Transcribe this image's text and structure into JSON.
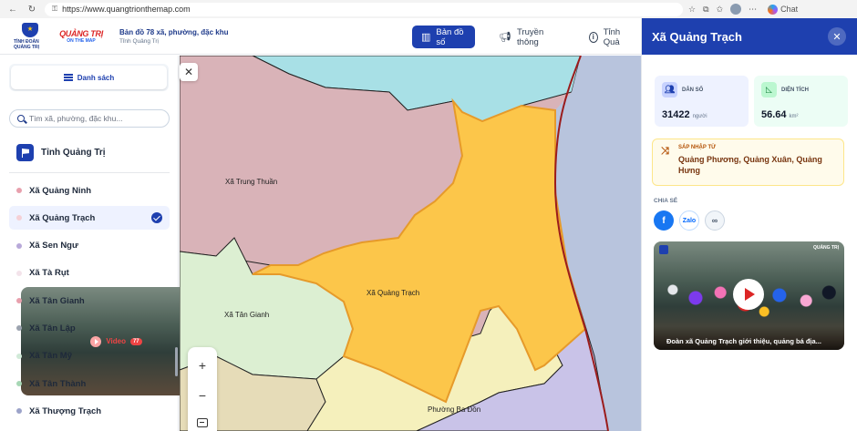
{
  "browser": {
    "url": "https://www.quangtrionthemap.com",
    "chat_label": "Chat"
  },
  "header": {
    "logo_caption": "TỈNH ĐOÀN QUẢNG TRỊ",
    "brand_main": "QUẢNG TRỊ",
    "brand_sub": "ON THE MAP",
    "title": "Bản đồ 78 xã, phường, đặc khu",
    "subtitle": "Tỉnh Quảng Trị",
    "tabs": [
      {
        "label": "Bản đồ số",
        "icon": "map-icon",
        "active": true
      },
      {
        "label": "Truyền thông",
        "icon": "megaphone-icon",
        "active": false
      },
      {
        "label": "Tỉnh Quả",
        "icon": "info-icon",
        "active": false
      }
    ]
  },
  "sidebar": {
    "tab_list": "Danh sách",
    "tab_video": "Video",
    "video_count": "77",
    "search_placeholder": "Tìm xã, phường, đặc khu...",
    "province": "Tỉnh Quảng Trị",
    "items": [
      {
        "label": "Xã Quảng Ninh",
        "color": "#e8a0ad"
      },
      {
        "label": "Xã Quảng Trạch",
        "color": "#f5d0d6",
        "selected": true
      },
      {
        "label": "Xã Sen Ngư",
        "color": "#b8a9d9"
      },
      {
        "label": "Xã Tà Rụt",
        "color": "#f3e3ea"
      },
      {
        "label": "Xã Tân Gianh",
        "color": "#e8a0ad"
      },
      {
        "label": "Xã Tân Lập",
        "color": "#9ca3af"
      },
      {
        "label": "Xã Tân Mỹ",
        "color": "#d1ead8"
      },
      {
        "label": "Xã Tân Thành",
        "color": "#a7d7b5"
      },
      {
        "label": "Xã Thượng Trạch",
        "color": "#9ca3c9"
      }
    ]
  },
  "map": {
    "labels": {
      "trung_thuan": "Xã Trung Thuần",
      "quang_trach": "Xã Quảng Trạch",
      "tan_gianh": "Xã Tân Gianh",
      "ba_don": "Phường Ba Đồn"
    },
    "zoom_in": "+",
    "zoom_out": "−",
    "colors": {
      "pink": "#d9b3b8",
      "cyan": "#a8e0e6",
      "yellow": "#fcc64a",
      "lightyellow": "#f5f0bc",
      "green": "#dcefd2",
      "lavender": "#c9c3e8",
      "sea": "#b8c4dd",
      "tan": "#e6dcb8"
    }
  },
  "panel": {
    "title": "Xã Quảng Trạch",
    "pop_label": "DÂN SỐ",
    "pop_value": "31422",
    "pop_unit": "người",
    "area_label": "DIỆN TÍCH",
    "area_value": "56.64",
    "area_unit": "km²",
    "merge_label": "SÁP NHẬP TỪ",
    "merge_value": "Quảng Phương, Quảng Xuân, Quảng Hưng",
    "share_label": "CHIA SẺ",
    "share_zalo": "Zalo",
    "video_caption": "Đoàn xã Quảng Trạch giới thiệu, quảng bá địa...",
    "video_brand": "QUẢNG TRỊ"
  }
}
